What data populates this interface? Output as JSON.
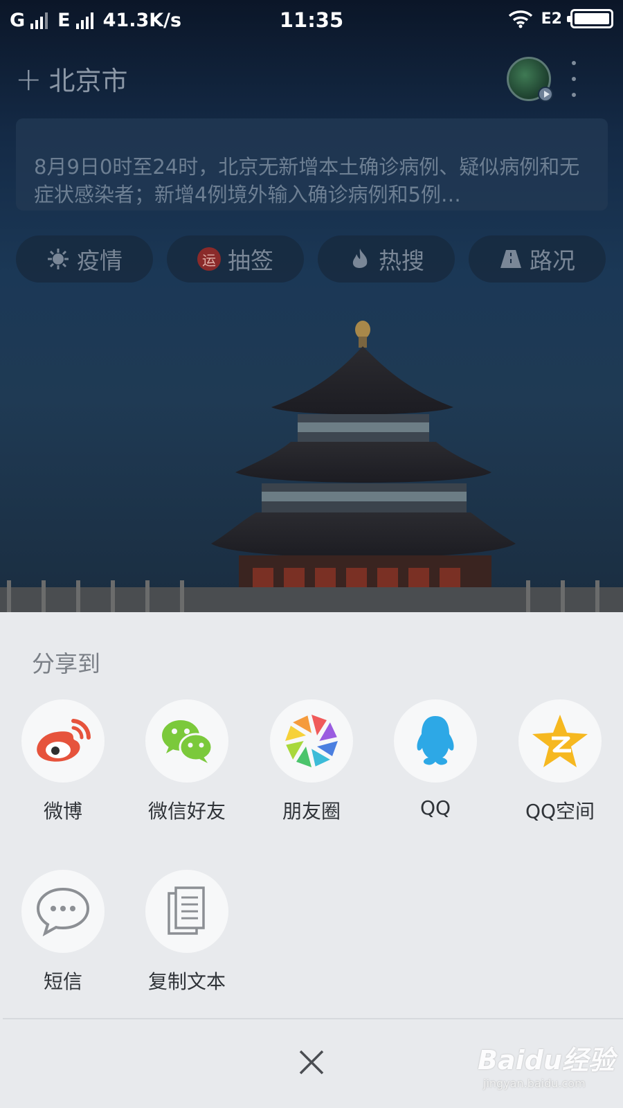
{
  "status_bar": {
    "carrier1": "G",
    "carrier2": "E",
    "net_speed": "41.3K/s",
    "time": "11:35",
    "data_type": "E2"
  },
  "header": {
    "add_icon": "plus-icon",
    "city": "北京市"
  },
  "news": {
    "text": "8月9日0时至24时，北京无新增本土确诊病例、疑似病例和无症状感染者；新增4例境外输入确诊病例和5例…"
  },
  "chips": [
    {
      "label": "疫情",
      "icon": "virus-icon"
    },
    {
      "label": "抽签",
      "icon": "fortune-icon",
      "badge": "运"
    },
    {
      "label": "热搜",
      "icon": "flame-icon"
    },
    {
      "label": "路况",
      "icon": "road-icon"
    }
  ],
  "share": {
    "title": "分享到",
    "items": [
      {
        "label": "微博",
        "icon": "weibo-icon"
      },
      {
        "label": "微信好友",
        "icon": "wechat-icon"
      },
      {
        "label": "朋友圈",
        "icon": "moments-icon"
      },
      {
        "label": "QQ",
        "icon": "qq-icon"
      },
      {
        "label": "QQ空间",
        "icon": "qzone-icon"
      },
      {
        "label": "短信",
        "icon": "sms-icon"
      },
      {
        "label": "复制文本",
        "icon": "copy-text-icon"
      }
    ],
    "close_icon": "close-icon"
  },
  "watermark": {
    "brand": "Baidu经验",
    "url": "jingyan.baidu.com"
  },
  "colors": {
    "sheet_bg": "#e8eaed",
    "weibo_red": "#e6533c",
    "wechat_green": "#7bc93b",
    "qq_blue": "#2da8e6",
    "qzone_yellow": "#f6b820"
  }
}
